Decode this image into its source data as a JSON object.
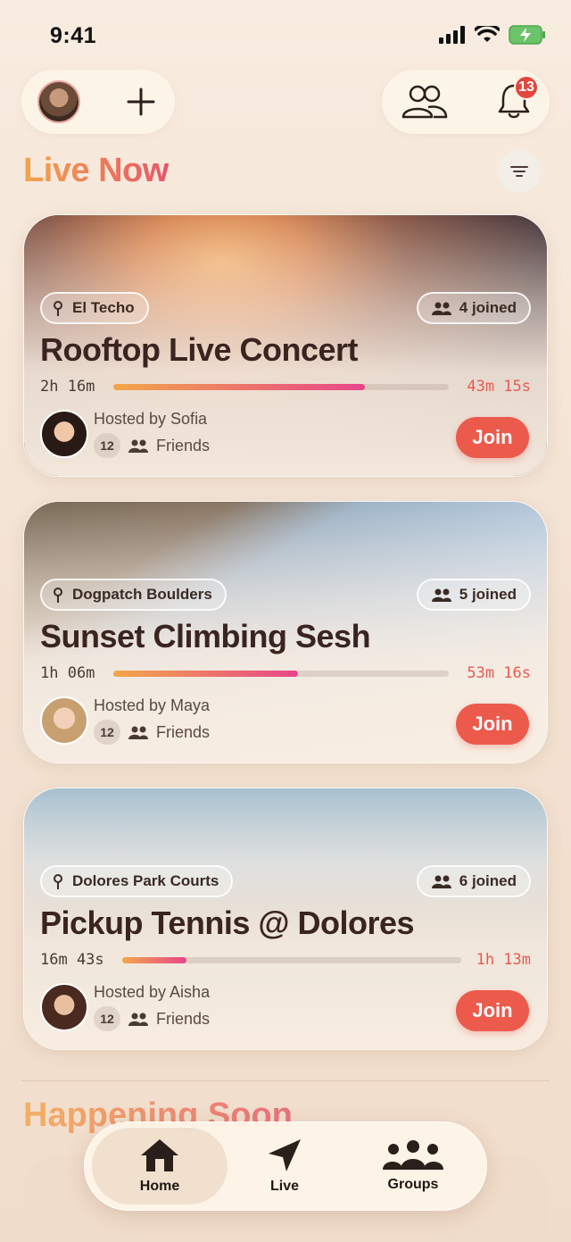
{
  "status_bar": {
    "time": "9:41"
  },
  "header": {
    "notification_count": "13"
  },
  "live_section": {
    "title": "Live Now"
  },
  "live_events": [
    {
      "location": "El Techo",
      "joined": "4 joined",
      "title": "Rooftop Live Concert",
      "elapsed": "2h 16m",
      "remaining": "43m 15s",
      "progress": 0.75,
      "host": "Hosted by Sofia",
      "friend_count": "12",
      "friends_label": "Friends",
      "join_label": "Join"
    },
    {
      "location": "Dogpatch Boulders",
      "joined": "5 joined",
      "title": "Sunset Climbing Sesh",
      "elapsed": "1h 06m",
      "remaining": "53m 16s",
      "progress": 0.55,
      "host": "Hosted by Maya",
      "friend_count": "12",
      "friends_label": "Friends",
      "join_label": "Join"
    },
    {
      "location": "Dolores Park Courts",
      "joined": "6 joined",
      "title": "Pickup Tennis @ Dolores",
      "elapsed": "16m 43s",
      "remaining": "1h 13m",
      "progress": 0.19,
      "host": "Hosted by Aisha",
      "friend_count": "12",
      "friends_label": "Friends",
      "join_label": "Join"
    }
  ],
  "soon_section": {
    "title": "Happening Soon"
  },
  "tab_bar": {
    "home": "Home",
    "live": "Live",
    "groups": "Groups"
  }
}
